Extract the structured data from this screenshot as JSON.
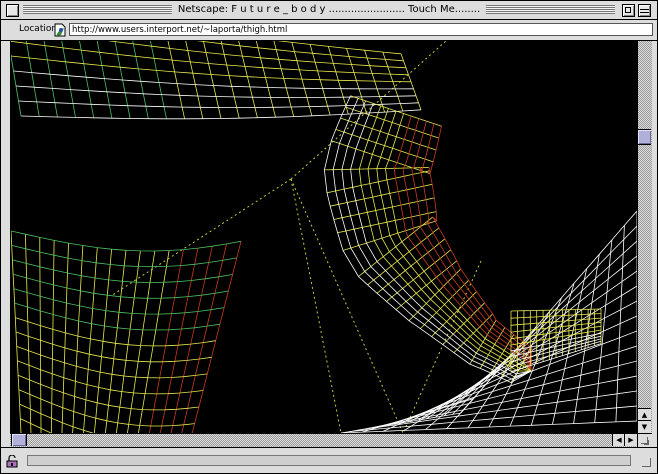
{
  "window": {
    "title": "Netscape: F u t u r e _ b o d y ........................ Touch Me........"
  },
  "location": {
    "label": "Location:",
    "url": "http://www.users.interport.net/~laporta/thigh.html"
  },
  "status": {
    "text": ""
  },
  "icons": {
    "close": "close-box-icon",
    "zoom": "zoom-box-icon",
    "collapse": "collapse-box-icon",
    "page_proxy": "page-proxy-icon",
    "security": "security-lock-icon"
  },
  "colors": {
    "chrome": "#dddddd",
    "content_background": "#000000",
    "scroll_thumb": "#b0b0d8",
    "wire_white": "#ffffff",
    "wire_yellow": "#e8e850",
    "wire_green": "#4cc060",
    "wire_red": "#c83a1c"
  }
}
